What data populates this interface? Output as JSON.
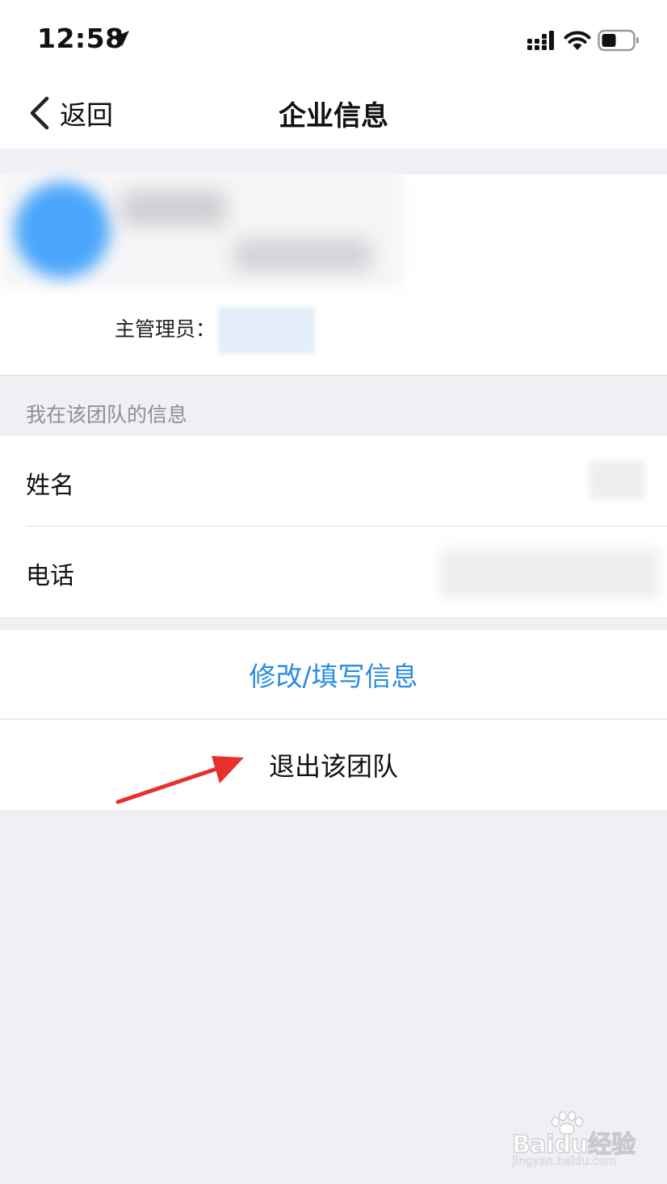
{
  "status_bar": {
    "time": "12:58",
    "icons": [
      "location-arrow-icon",
      "cellular-signal-icon",
      "wifi-icon",
      "battery-icon"
    ]
  },
  "nav": {
    "back_label": "返回",
    "title": "企业信息"
  },
  "team_card": {
    "admin_label": "主管理员："
  },
  "my_info": {
    "section_title": "我在该团队的信息",
    "name_label": "姓名",
    "phone_label": "电话"
  },
  "actions": {
    "edit_label": "修改/填写信息",
    "quit_label": "退出该团队"
  },
  "watermark": {
    "logo_text": "Baidu经验",
    "url": "jingyan.baidu.com"
  },
  "colors": {
    "accent": "#2a8ce0",
    "page_bg": "#efeff4",
    "annotation_arrow": "#e8302b"
  }
}
